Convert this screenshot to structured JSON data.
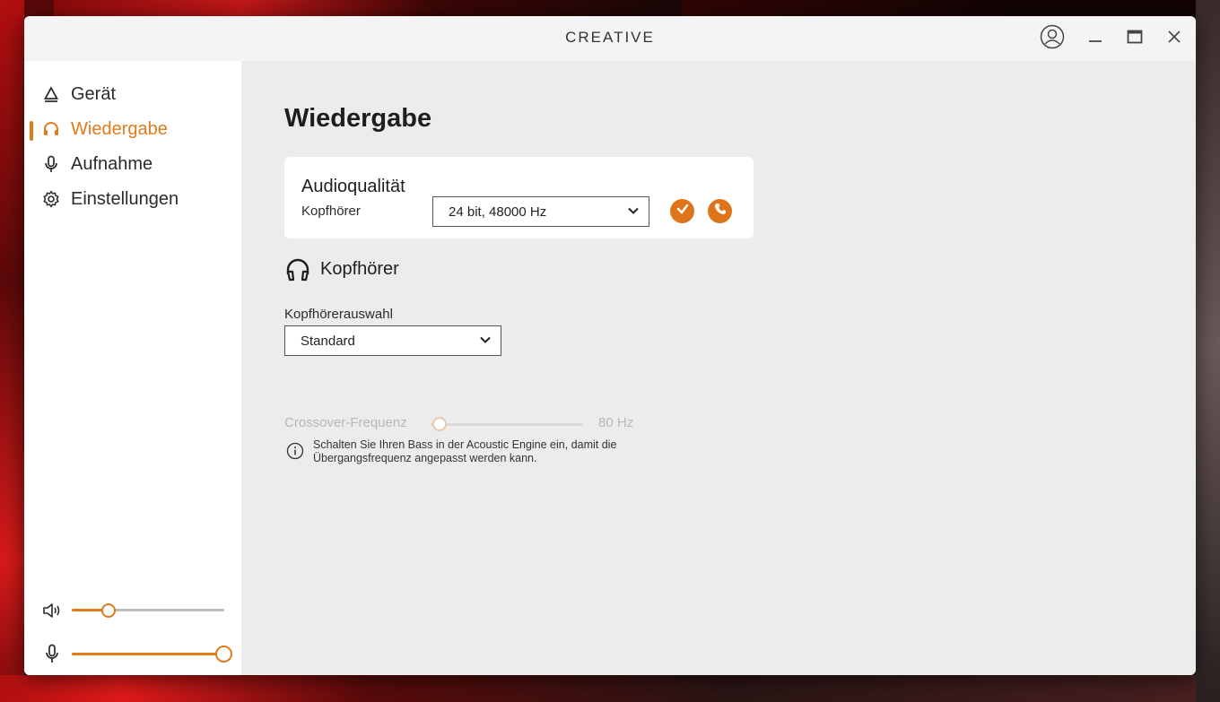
{
  "window": {
    "logo": "CREATIVE",
    "controls": [
      "account-icon",
      "minimize-icon",
      "maximize-icon",
      "close-icon"
    ]
  },
  "sidebar": {
    "items": [
      {
        "label": "Gerät",
        "icon": "device-triangle-icon",
        "active": false
      },
      {
        "label": "Wiedergabe",
        "icon": "headphones-icon",
        "active": true
      },
      {
        "label": "Aufnahme",
        "icon": "microphone-icon",
        "active": false
      },
      {
        "label": "Einstellungen",
        "icon": "gear-icon",
        "active": false
      }
    ],
    "volume": {
      "icon": "speaker-icon",
      "level": 0.25
    },
    "mic_level": {
      "icon": "microphone-icon",
      "level": 1.0
    }
  },
  "main": {
    "title": "Wiedergabe",
    "audio_quality": {
      "title": "Audioqualität",
      "label": "Kopfhörer",
      "value": "24 bit, 48000 Hz"
    },
    "headphones": {
      "title": "Kopfhörer",
      "selection_label": "Kopfhörerauswahl",
      "selection_value": "Standard",
      "crossover_label": "Crossover-Frequenz",
      "crossover_value": "80 Hz",
      "crossover_level": 0.0,
      "info": "Schalten Sie Ihren Bass in der Acoustic Engine ein, damit die Übergangsfrequenz angepasst werden kann."
    }
  },
  "colors": {
    "accent": "#e07b1a",
    "window_bg": "#ececec",
    "sidebar_bg": "#ffffff"
  }
}
